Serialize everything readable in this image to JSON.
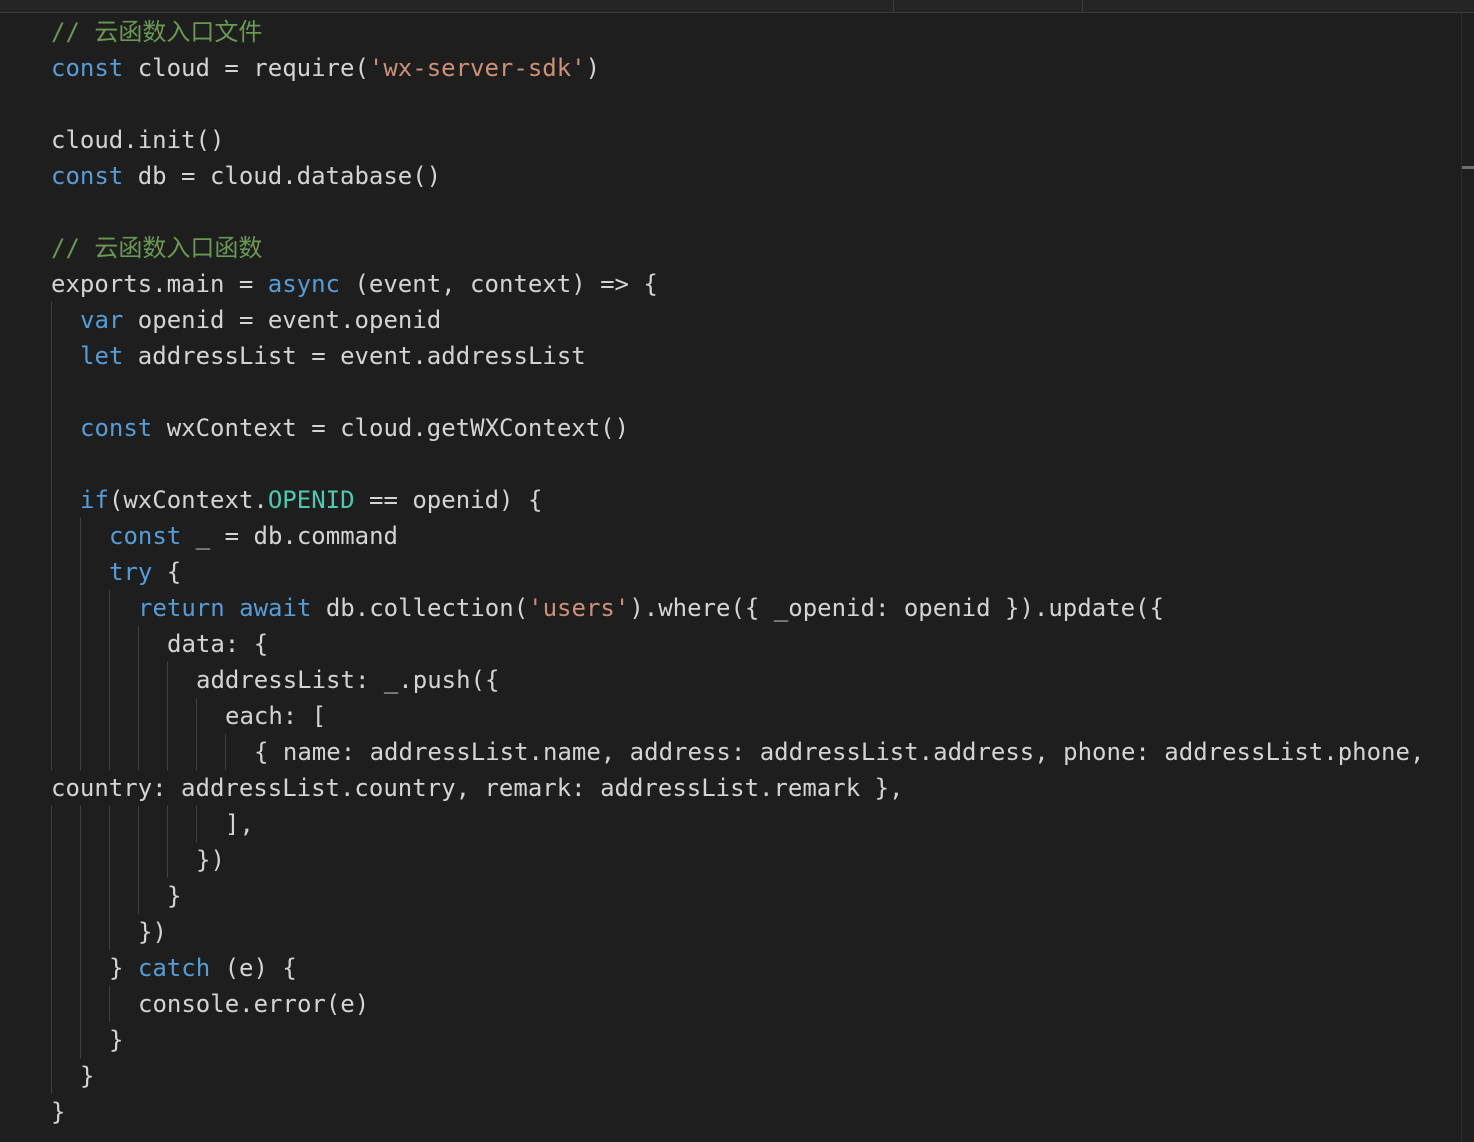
{
  "editor": {
    "language": "javascript",
    "lines": [
      {
        "indent": 0,
        "guides": 0,
        "tokens": [
          {
            "t": "// 云函数入口文件",
            "c": "cm"
          }
        ]
      },
      {
        "indent": 0,
        "guides": 0,
        "tokens": [
          {
            "t": "const",
            "c": "kw"
          },
          {
            "t": " cloud = require(",
            "c": ""
          },
          {
            "t": "'wx-server-sdk'",
            "c": "str"
          },
          {
            "t": ")",
            "c": ""
          }
        ]
      },
      {
        "indent": 0,
        "guides": 0,
        "tokens": []
      },
      {
        "indent": 0,
        "guides": 0,
        "tokens": [
          {
            "t": "cloud.init()",
            "c": ""
          }
        ]
      },
      {
        "indent": 0,
        "guides": 0,
        "tokens": [
          {
            "t": "const",
            "c": "kw"
          },
          {
            "t": " db = cloud.database()",
            "c": ""
          }
        ]
      },
      {
        "indent": 0,
        "guides": 0,
        "tokens": []
      },
      {
        "indent": 0,
        "guides": 0,
        "tokens": [
          {
            "t": "// 云函数入口函数",
            "c": "cm"
          }
        ]
      },
      {
        "indent": 0,
        "guides": 0,
        "tokens": [
          {
            "t": "exports.main = ",
            "c": ""
          },
          {
            "t": "async",
            "c": "kw"
          },
          {
            "t": " (event, context) => {",
            "c": ""
          }
        ]
      },
      {
        "indent": 1,
        "guides": 1,
        "tokens": [
          {
            "t": "var",
            "c": "kw"
          },
          {
            "t": " openid = event.openid",
            "c": ""
          }
        ]
      },
      {
        "indent": 1,
        "guides": 1,
        "tokens": [
          {
            "t": "let",
            "c": "kw"
          },
          {
            "t": " addressList = event.addressList",
            "c": ""
          }
        ]
      },
      {
        "indent": 1,
        "guides": 1,
        "tokens": []
      },
      {
        "indent": 1,
        "guides": 1,
        "tokens": [
          {
            "t": "const",
            "c": "kw"
          },
          {
            "t": " wxContext = cloud.getWXContext()",
            "c": ""
          }
        ]
      },
      {
        "indent": 1,
        "guides": 1,
        "tokens": []
      },
      {
        "indent": 1,
        "guides": 1,
        "tokens": [
          {
            "t": "if",
            "c": "kw"
          },
          {
            "t": "(wxContext.",
            "c": ""
          },
          {
            "t": "OPENID",
            "c": "const"
          },
          {
            "t": " == openid) {",
            "c": ""
          }
        ]
      },
      {
        "indent": 2,
        "guides": 2,
        "tokens": [
          {
            "t": "const",
            "c": "kw"
          },
          {
            "t": " _ = db.command",
            "c": ""
          }
        ]
      },
      {
        "indent": 2,
        "guides": 2,
        "tokens": [
          {
            "t": "try",
            "c": "kw"
          },
          {
            "t": " {",
            "c": ""
          }
        ]
      },
      {
        "indent": 3,
        "guides": 3,
        "tokens": [
          {
            "t": "return",
            "c": "kw"
          },
          {
            "t": " ",
            "c": ""
          },
          {
            "t": "await",
            "c": "kw"
          },
          {
            "t": " db.collection(",
            "c": ""
          },
          {
            "t": "'users'",
            "c": "str"
          },
          {
            "t": ").where({ _openid: openid }).update({",
            "c": ""
          }
        ]
      },
      {
        "indent": 4,
        "guides": 4,
        "tokens": [
          {
            "t": "data: {",
            "c": ""
          }
        ]
      },
      {
        "indent": 5,
        "guides": 5,
        "tokens": [
          {
            "t": "addressList: _.push({",
            "c": ""
          }
        ]
      },
      {
        "indent": 6,
        "guides": 6,
        "tokens": [
          {
            "t": "each: [",
            "c": ""
          }
        ]
      },
      {
        "indent": 7,
        "guides": 7,
        "tokens": [
          {
            "t": "{ name: addressList.name, address: addressList.address, phone: addressList.phone,",
            "c": ""
          }
        ]
      },
      {
        "indent": 0,
        "guides": 0,
        "tokens": [
          {
            "t": "country: addressList.country, remark: addressList.remark },",
            "c": ""
          }
        ]
      },
      {
        "indent": 6,
        "guides": 6,
        "tokens": [
          {
            "t": "],",
            "c": ""
          }
        ]
      },
      {
        "indent": 5,
        "guides": 5,
        "tokens": [
          {
            "t": "})",
            "c": ""
          }
        ]
      },
      {
        "indent": 4,
        "guides": 4,
        "tokens": [
          {
            "t": "}",
            "c": ""
          }
        ]
      },
      {
        "indent": 3,
        "guides": 3,
        "tokens": [
          {
            "t": "})",
            "c": ""
          }
        ]
      },
      {
        "indent": 2,
        "guides": 2,
        "tokens": [
          {
            "t": "} ",
            "c": ""
          },
          {
            "t": "catch",
            "c": "kw"
          },
          {
            "t": " (e) {",
            "c": ""
          }
        ]
      },
      {
        "indent": 3,
        "guides": 3,
        "tokens": [
          {
            "t": "console.error(e)",
            "c": ""
          }
        ]
      },
      {
        "indent": 2,
        "guides": 2,
        "tokens": [
          {
            "t": "}",
            "c": ""
          }
        ]
      },
      {
        "indent": 1,
        "guides": 1,
        "tokens": [
          {
            "t": "}",
            "c": ""
          }
        ]
      },
      {
        "indent": 0,
        "guides": 0,
        "tokens": [
          {
            "t": "}",
            "c": ""
          }
        ]
      }
    ]
  }
}
